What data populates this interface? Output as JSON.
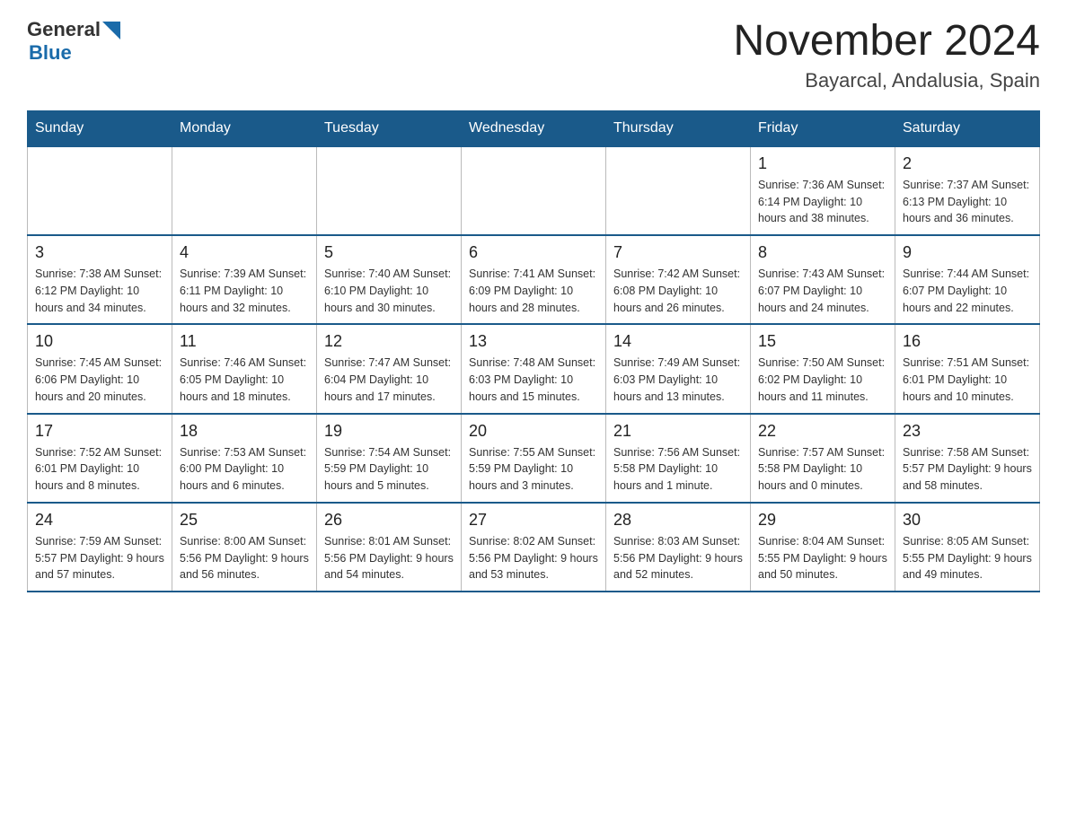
{
  "logo": {
    "text_general": "General",
    "text_blue": "Blue"
  },
  "title": "November 2024",
  "subtitle": "Bayarcal, Andalusia, Spain",
  "days_of_week": [
    "Sunday",
    "Monday",
    "Tuesday",
    "Wednesday",
    "Thursday",
    "Friday",
    "Saturday"
  ],
  "weeks": [
    [
      {
        "day": "",
        "info": ""
      },
      {
        "day": "",
        "info": ""
      },
      {
        "day": "",
        "info": ""
      },
      {
        "day": "",
        "info": ""
      },
      {
        "day": "",
        "info": ""
      },
      {
        "day": "1",
        "info": "Sunrise: 7:36 AM\nSunset: 6:14 PM\nDaylight: 10 hours and 38 minutes."
      },
      {
        "day": "2",
        "info": "Sunrise: 7:37 AM\nSunset: 6:13 PM\nDaylight: 10 hours and 36 minutes."
      }
    ],
    [
      {
        "day": "3",
        "info": "Sunrise: 7:38 AM\nSunset: 6:12 PM\nDaylight: 10 hours and 34 minutes."
      },
      {
        "day": "4",
        "info": "Sunrise: 7:39 AM\nSunset: 6:11 PM\nDaylight: 10 hours and 32 minutes."
      },
      {
        "day": "5",
        "info": "Sunrise: 7:40 AM\nSunset: 6:10 PM\nDaylight: 10 hours and 30 minutes."
      },
      {
        "day": "6",
        "info": "Sunrise: 7:41 AM\nSunset: 6:09 PM\nDaylight: 10 hours and 28 minutes."
      },
      {
        "day": "7",
        "info": "Sunrise: 7:42 AM\nSunset: 6:08 PM\nDaylight: 10 hours and 26 minutes."
      },
      {
        "day": "8",
        "info": "Sunrise: 7:43 AM\nSunset: 6:07 PM\nDaylight: 10 hours and 24 minutes."
      },
      {
        "day": "9",
        "info": "Sunrise: 7:44 AM\nSunset: 6:07 PM\nDaylight: 10 hours and 22 minutes."
      }
    ],
    [
      {
        "day": "10",
        "info": "Sunrise: 7:45 AM\nSunset: 6:06 PM\nDaylight: 10 hours and 20 minutes."
      },
      {
        "day": "11",
        "info": "Sunrise: 7:46 AM\nSunset: 6:05 PM\nDaylight: 10 hours and 18 minutes."
      },
      {
        "day": "12",
        "info": "Sunrise: 7:47 AM\nSunset: 6:04 PM\nDaylight: 10 hours and 17 minutes."
      },
      {
        "day": "13",
        "info": "Sunrise: 7:48 AM\nSunset: 6:03 PM\nDaylight: 10 hours and 15 minutes."
      },
      {
        "day": "14",
        "info": "Sunrise: 7:49 AM\nSunset: 6:03 PM\nDaylight: 10 hours and 13 minutes."
      },
      {
        "day": "15",
        "info": "Sunrise: 7:50 AM\nSunset: 6:02 PM\nDaylight: 10 hours and 11 minutes."
      },
      {
        "day": "16",
        "info": "Sunrise: 7:51 AM\nSunset: 6:01 PM\nDaylight: 10 hours and 10 minutes."
      }
    ],
    [
      {
        "day": "17",
        "info": "Sunrise: 7:52 AM\nSunset: 6:01 PM\nDaylight: 10 hours and 8 minutes."
      },
      {
        "day": "18",
        "info": "Sunrise: 7:53 AM\nSunset: 6:00 PM\nDaylight: 10 hours and 6 minutes."
      },
      {
        "day": "19",
        "info": "Sunrise: 7:54 AM\nSunset: 5:59 PM\nDaylight: 10 hours and 5 minutes."
      },
      {
        "day": "20",
        "info": "Sunrise: 7:55 AM\nSunset: 5:59 PM\nDaylight: 10 hours and 3 minutes."
      },
      {
        "day": "21",
        "info": "Sunrise: 7:56 AM\nSunset: 5:58 PM\nDaylight: 10 hours and 1 minute."
      },
      {
        "day": "22",
        "info": "Sunrise: 7:57 AM\nSunset: 5:58 PM\nDaylight: 10 hours and 0 minutes."
      },
      {
        "day": "23",
        "info": "Sunrise: 7:58 AM\nSunset: 5:57 PM\nDaylight: 9 hours and 58 minutes."
      }
    ],
    [
      {
        "day": "24",
        "info": "Sunrise: 7:59 AM\nSunset: 5:57 PM\nDaylight: 9 hours and 57 minutes."
      },
      {
        "day": "25",
        "info": "Sunrise: 8:00 AM\nSunset: 5:56 PM\nDaylight: 9 hours and 56 minutes."
      },
      {
        "day": "26",
        "info": "Sunrise: 8:01 AM\nSunset: 5:56 PM\nDaylight: 9 hours and 54 minutes."
      },
      {
        "day": "27",
        "info": "Sunrise: 8:02 AM\nSunset: 5:56 PM\nDaylight: 9 hours and 53 minutes."
      },
      {
        "day": "28",
        "info": "Sunrise: 8:03 AM\nSunset: 5:56 PM\nDaylight: 9 hours and 52 minutes."
      },
      {
        "day": "29",
        "info": "Sunrise: 8:04 AM\nSunset: 5:55 PM\nDaylight: 9 hours and 50 minutes."
      },
      {
        "day": "30",
        "info": "Sunrise: 8:05 AM\nSunset: 5:55 PM\nDaylight: 9 hours and 49 minutes."
      }
    ]
  ]
}
